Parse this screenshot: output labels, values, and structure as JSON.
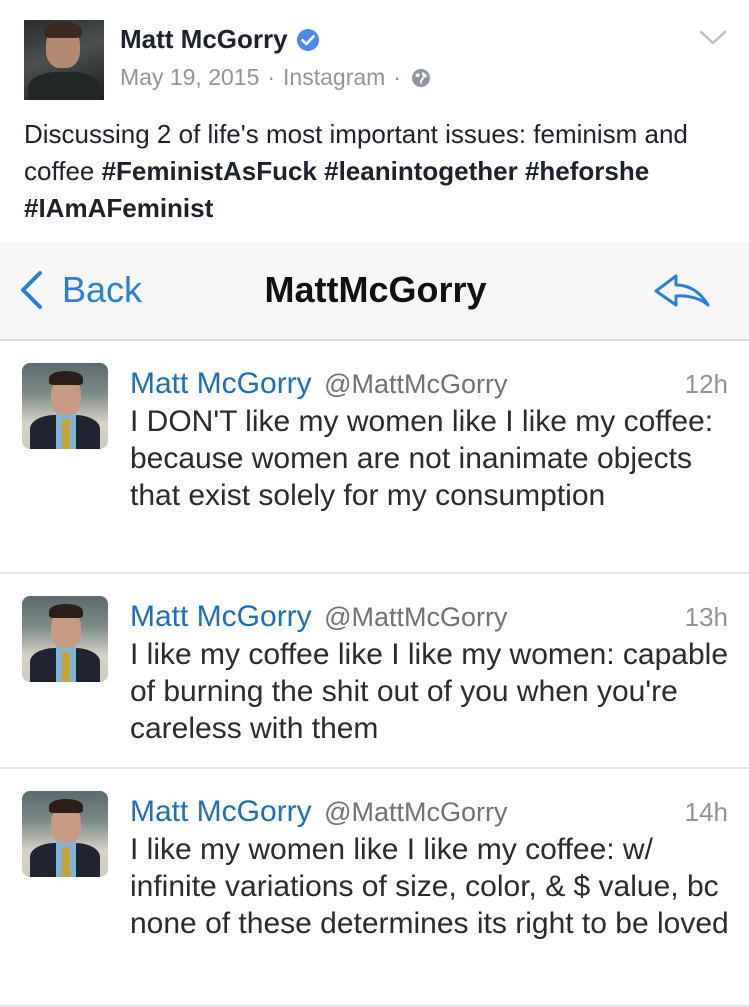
{
  "post": {
    "author": "Matt McGorry",
    "date": "May 19, 2015",
    "separator": "·",
    "source": "Instagram",
    "caption_text": "Discussing 2 of life's most important issues: feminism and coffee",
    "hashtags": [
      "#FeministAsFuck",
      "#leanintogether",
      "#heforshe",
      "#IAmAFeminist"
    ]
  },
  "twitter": {
    "back_label": "Back",
    "nav_title": "MattMcGorry",
    "tweets": [
      {
        "name": "Matt McGorry",
        "handle": "@MattMcGorry",
        "time": "12h",
        "text": "I DON'T like my women like I like my coffee: because women are not inanimate objects that exist solely for my consumption"
      },
      {
        "name": "Matt McGorry",
        "handle": "@MattMcGorry",
        "time": "13h",
        "text": "I like my coffee like I like my women: capable of burning the shit out of you when you're careless with them"
      },
      {
        "name": "Matt McGorry",
        "handle": "@MattMcGorry",
        "time": "14h",
        "text": "I like my women like I like my coffee: w/ infinite variations of size, color, & $ value, bc none of these determines its right to be loved"
      }
    ]
  },
  "colors": {
    "link_blue": "#2a7fd6",
    "tweet_name_blue": "#1d6fb8",
    "verified_blue": "#4b88f4",
    "meta_gray": "#90949c"
  },
  "icons": [
    "verified-icon",
    "globe-icon",
    "chevron-down-icon",
    "back-chevron-icon",
    "reply-icon"
  ]
}
